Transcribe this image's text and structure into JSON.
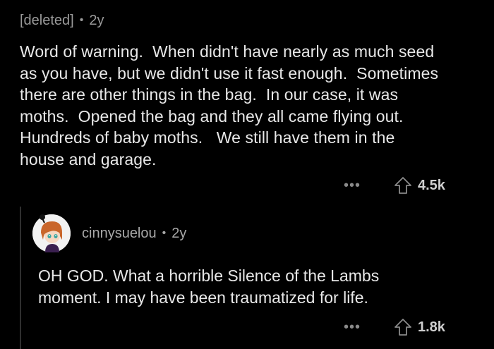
{
  "parent": {
    "author": "[deleted]",
    "age": "2y",
    "body": "Word of warning.  When didn't have nearly as much seed as you have, but we didn't use it fast enough.  Sometimes there are other things in the bag.  In our case, it was moths.  Opened the bag and they all came flying out.   Hundreds of baby moths.   We still have them in the house and garage.",
    "upvotes": "4.5k",
    "more_icon": "•••"
  },
  "reply": {
    "author": "cinnysuelou",
    "age": "2y",
    "body": "OH GOD. What a horrible Silence of the Lambs moment. I may have been traumatized for life.",
    "upvotes": "1.8k",
    "more_icon": "•••"
  },
  "separator": "•",
  "colors": {
    "background": "#000000",
    "text": "#e8e8e8",
    "meta": "#9a9a9a",
    "thread_line": "#2f2f2f"
  }
}
